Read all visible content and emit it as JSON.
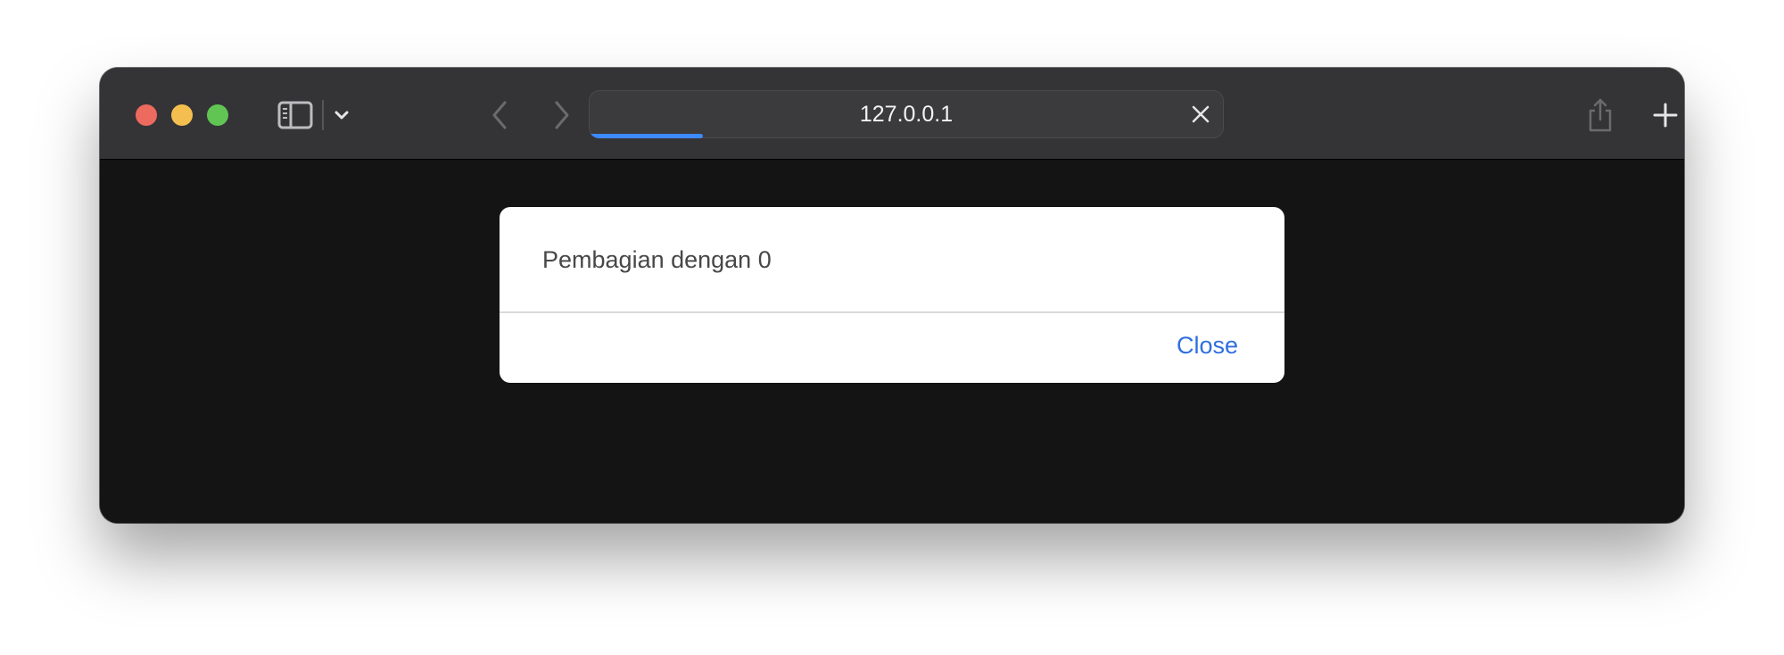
{
  "browser": {
    "address_bar": {
      "url": "127.0.0.1",
      "load_progress": 0.18
    },
    "icons": {
      "sidebar": "sidebar-toggle-icon",
      "tab_group_menu": "chevron-down-icon",
      "back": "chevron-left-icon",
      "forward": "chevron-right-icon",
      "privacy": "shield-icon",
      "stop": "close-icon",
      "share": "share-icon",
      "new_tab": "plus-icon",
      "tab_overview": "tabs-overview-icon"
    },
    "colors": {
      "toolbar": "#343437",
      "content_background": "#141414",
      "progress": "#3d89ff",
      "traffic_close": "#ed6a5e",
      "traffic_minimize": "#f5bf4f",
      "traffic_zoom": "#61c554"
    }
  },
  "dialog": {
    "message": "Pembagian dengan 0",
    "close_label": "Close",
    "accent_color": "#2f6fde"
  }
}
